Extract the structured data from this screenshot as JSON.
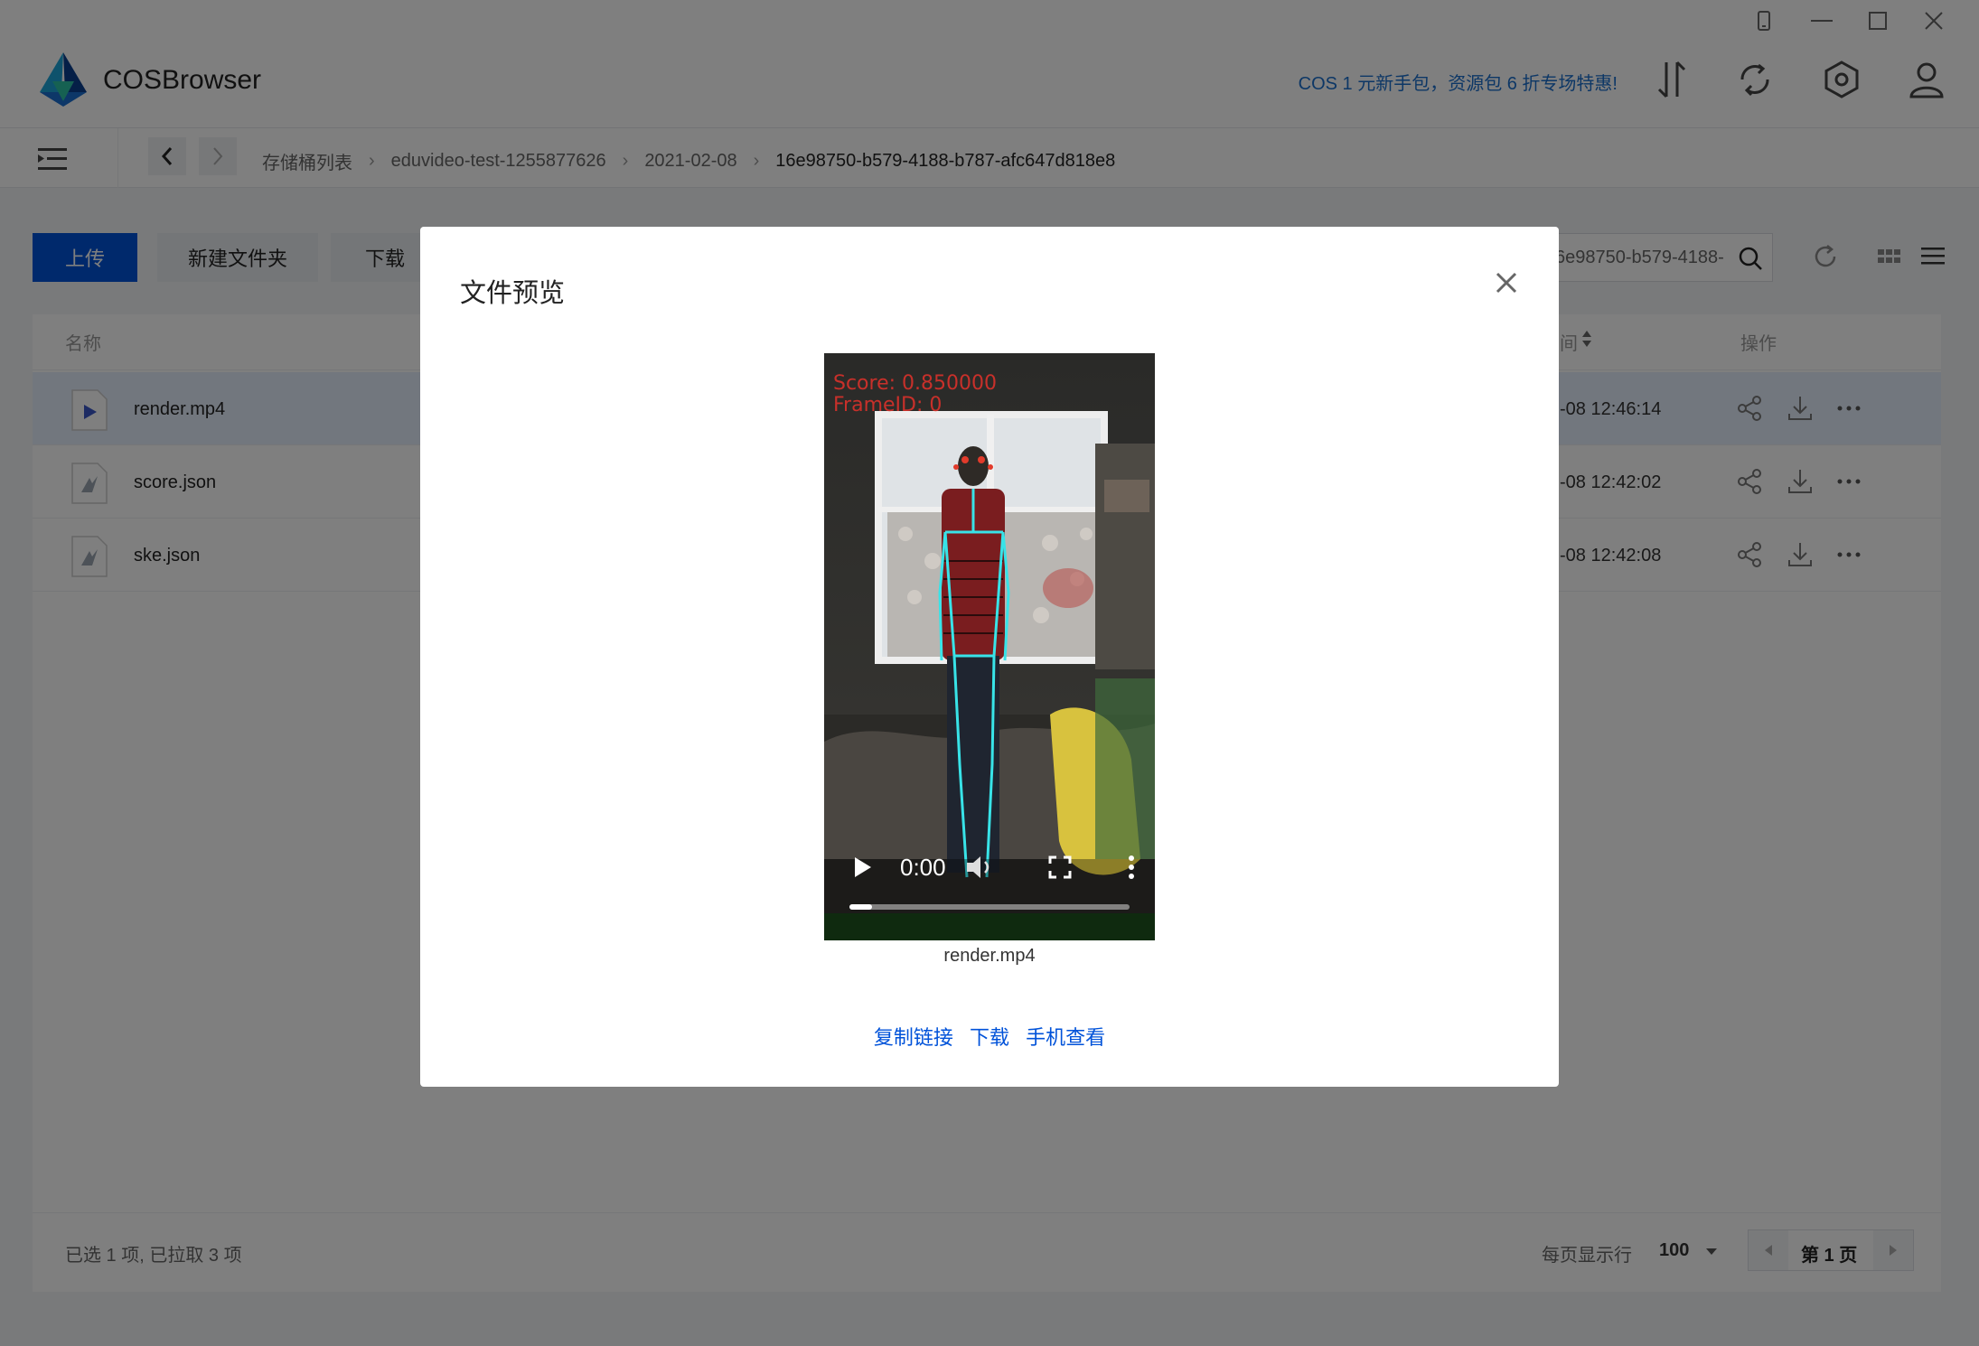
{
  "app": {
    "name": "COSBrowser",
    "promo": "COS 1 元新手包，资源包 6 折专场特惠!"
  },
  "breadcrumb": {
    "items": [
      "存储桶列表",
      "eduvideo-test-1255877626",
      "2021-02-08",
      "16e98750-b579-4188-b787-afc647d818e8"
    ]
  },
  "toolbar": {
    "upload": "上传",
    "new_folder": "新建文件夹",
    "download": "下载"
  },
  "search": {
    "value": "6e98750-b579-4188-"
  },
  "table": {
    "col_name": "名称",
    "col_time": "间",
    "col_ops": "操作",
    "rows": [
      {
        "name": "render.mp4",
        "date": "-08 12:46:14",
        "selected": true,
        "type": "video"
      },
      {
        "name": "score.json",
        "date": "-08 12:42:02",
        "selected": false,
        "type": "file"
      },
      {
        "name": "ske.json",
        "date": "-08 12:42:08",
        "selected": false,
        "type": "file"
      }
    ]
  },
  "footer": {
    "status": "已选 1 项, 已拉取 3 项",
    "per_page_label": "每页显示行",
    "per_page_value": "100",
    "page_label": "第 1 页"
  },
  "modal": {
    "title": "文件预览",
    "video": {
      "overlay_score": "Score: 0.850000",
      "overlay_frame": "FrameID: 0",
      "time": "0:00",
      "progress": 0.08
    },
    "caption": "render.mp4",
    "links": [
      "复制链接",
      "下载",
      "手机查看"
    ]
  },
  "colors": {
    "accent": "#0052d9",
    "promo": "#1a6ecc",
    "skeleton": "#38e3e8"
  }
}
